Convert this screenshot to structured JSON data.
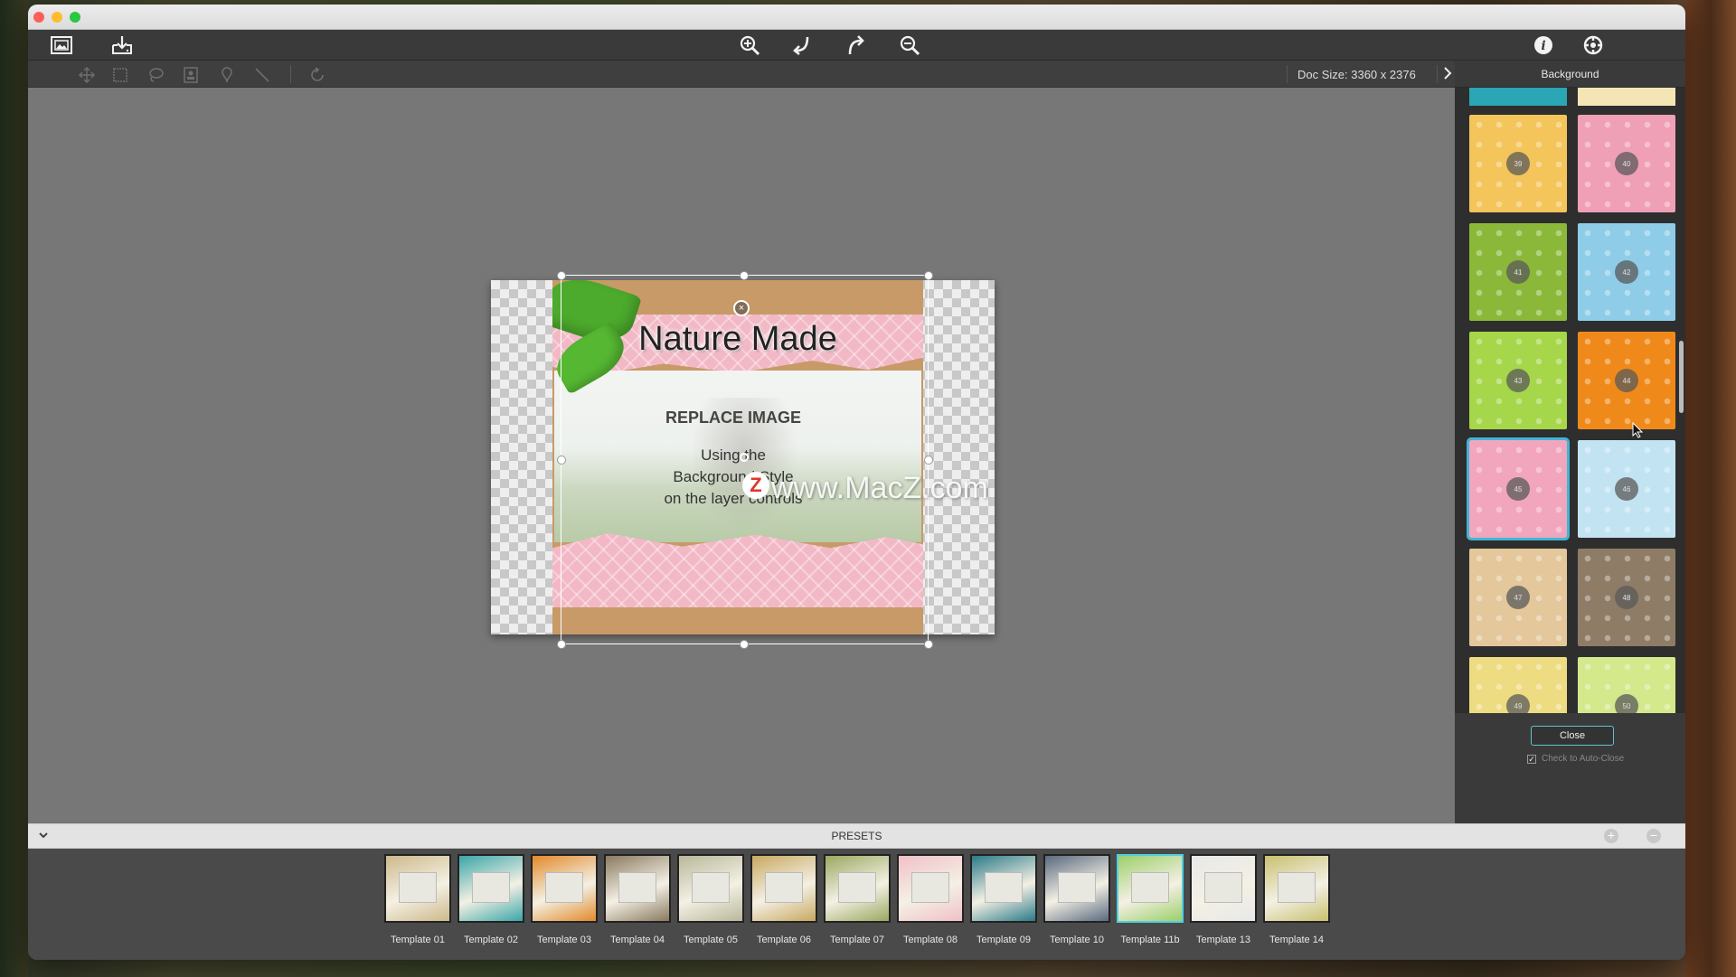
{
  "toolbar": {
    "doc_size": "Doc Size: 3360 x 2376"
  },
  "panel": {
    "title": "Background",
    "close_label": "Close",
    "auto_close_label": "Check to Auto-Close",
    "auto_close_checked": true,
    "thumbnails": [
      {
        "num": "39",
        "color": "#f4c55a"
      },
      {
        "num": "40",
        "color": "#f0a0b6"
      },
      {
        "num": "41",
        "color": "#8cb83a"
      },
      {
        "num": "42",
        "color": "#8fcce8"
      },
      {
        "num": "43",
        "color": "#a6d64a"
      },
      {
        "num": "44",
        "color": "#ef8a1a"
      },
      {
        "num": "45",
        "color": "#f1a6bd"
      },
      {
        "num": "46",
        "color": "#c2e4f2"
      },
      {
        "num": "47",
        "color": "#e4c79a"
      },
      {
        "num": "48",
        "color": "#8e7c66"
      },
      {
        "num": "49",
        "color": "#eedc82"
      },
      {
        "num": "50",
        "color": "#d4e88c"
      }
    ]
  },
  "canvas": {
    "title": "Nature Made",
    "replace": "REPLACE IMAGE",
    "line1": "Using the",
    "line2": "Background Style",
    "line3": "on the layer controls",
    "watermark": "www.MacZ.com"
  },
  "presets": {
    "title": "PRESETS",
    "items": [
      {
        "label": "Template 01",
        "color": "#cdb98a"
      },
      {
        "label": "Template 02",
        "color": "#3aa6a8"
      },
      {
        "label": "Template 03",
        "color": "#e28a2a"
      },
      {
        "label": "Template 04",
        "color": "#8a7a60"
      },
      {
        "label": "Template 05",
        "color": "#b8b89a"
      },
      {
        "label": "Template 06",
        "color": "#c8a860"
      },
      {
        "label": "Template 07",
        "color": "#9aa860"
      },
      {
        "label": "Template 08",
        "color": "#f0c0c8"
      },
      {
        "label": "Template 09",
        "color": "#2a7a88"
      },
      {
        "label": "Template 10",
        "color": "#5a6a80"
      },
      {
        "label": "Template 11b",
        "color": "#9ccf6a"
      },
      {
        "label": "Template 13",
        "color": "#e8e8e8"
      },
      {
        "label": "Template 14",
        "color": "#c8c070"
      }
    ]
  }
}
